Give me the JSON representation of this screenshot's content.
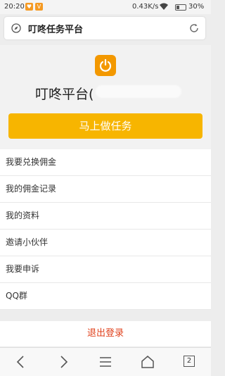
{
  "status_bar": {
    "time": "20:20",
    "app_badge_1": "♥",
    "app_badge_2": "V",
    "network_speed": "0.43K/s",
    "battery": "30%"
  },
  "url_bar": {
    "title": "叮咚任务平台"
  },
  "profile": {
    "name": "叮咚平台("
  },
  "primary_button": "马上做任务",
  "menu_items": [
    "我要兑换佣金",
    "我的佣金记录",
    "我的资料",
    "邀请小伙伴",
    "我要申诉",
    "QQ群"
  ],
  "logout": "退出登录",
  "nav": {
    "tab_count": "2"
  },
  "colors": {
    "accent": "#f7b500",
    "logo": "#f39800",
    "logout": "#e0411c"
  },
  "icons": [
    "compass-icon",
    "refresh-icon",
    "power-icon",
    "back-icon",
    "forward-icon",
    "menu-icon",
    "home-icon"
  ]
}
